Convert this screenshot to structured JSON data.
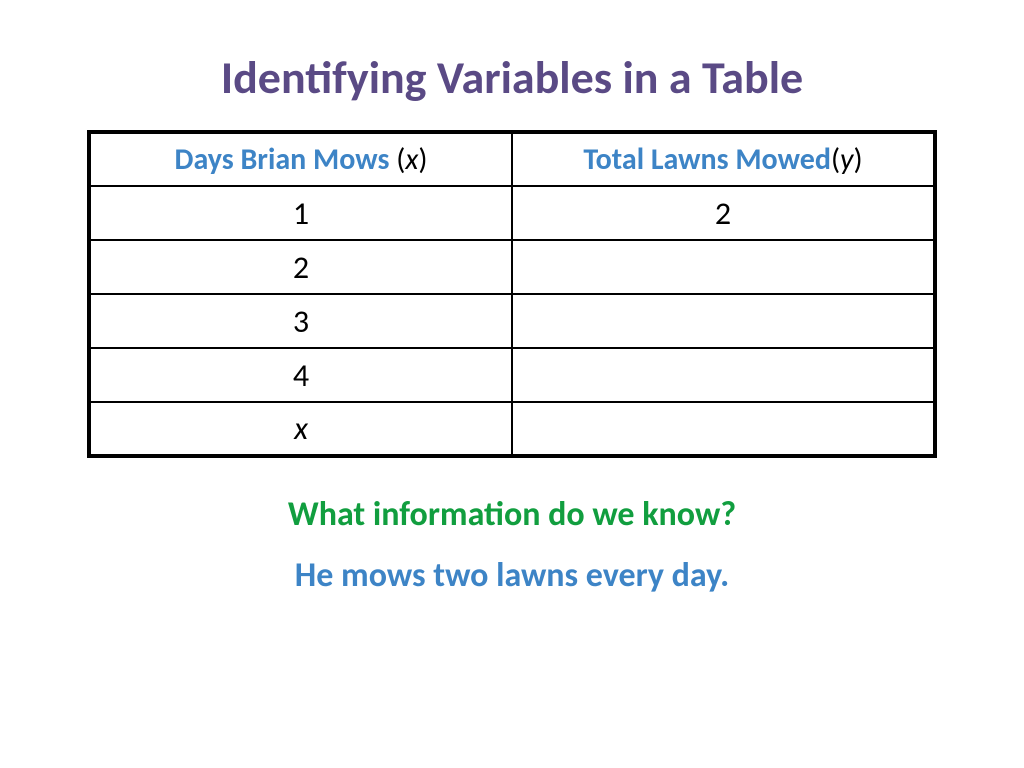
{
  "title": "Identifying Variables in a Table",
  "table": {
    "headers": {
      "col1_label": "Days Brian Mows",
      "col1_var_open": " (",
      "col1_var": "x",
      "col1_var_close": ")",
      "col2_label": "Total Lawns Mowed",
      "col2_var_open": "(",
      "col2_var": "y",
      "col2_var_close": ")"
    },
    "rows": [
      {
        "x": "1",
        "y": "2",
        "x_italic": false
      },
      {
        "x": "2",
        "y": "",
        "x_italic": false
      },
      {
        "x": "3",
        "y": "",
        "x_italic": false
      },
      {
        "x": "4",
        "y": "",
        "x_italic": false
      },
      {
        "x": "x",
        "y": "",
        "x_italic": true
      }
    ]
  },
  "question": "What information do we know?",
  "answer": "He mows two lawns every day.",
  "chart_data": {
    "type": "table",
    "title": "Identifying Variables in a Table",
    "columns": [
      "Days Brian Mows (x)",
      "Total Lawns Mowed (y)"
    ],
    "rows": [
      [
        "1",
        "2"
      ],
      [
        "2",
        ""
      ],
      [
        "3",
        ""
      ],
      [
        "4",
        ""
      ],
      [
        "x",
        ""
      ]
    ]
  }
}
